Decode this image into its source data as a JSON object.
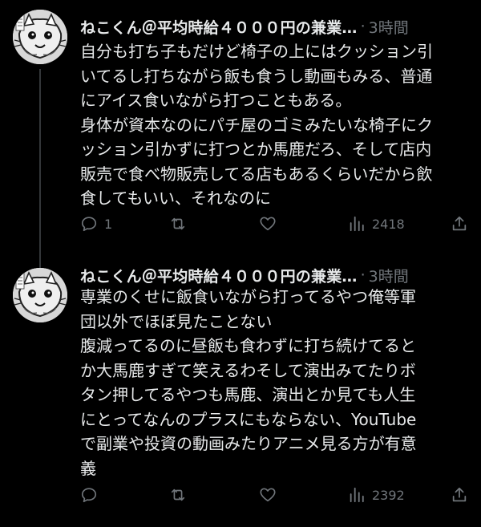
{
  "thread": {
    "tweets": [
      {
        "author": "ねこくん＠平均時給４０００円の兼業…",
        "time": "3時間",
        "more": "···",
        "lines": [
          "自分も打ち子もだけど椅子の上にはクッション引",
          "いてるし打ちながら飯も食うし動画もみる、普通",
          "にアイス食いながら打つこともある。",
          "身体が資本なのにパチ屋のゴミみたいな椅子にク",
          "ッション引かずに打つとか馬鹿だろ、そして店内",
          "販売で食べ物販売してる店もあるくらいだから飲",
          "食してもいい、それなのに"
        ],
        "actions": {
          "reply_count": "1",
          "retweet_count": "",
          "like_count": "",
          "views_count": "2418"
        }
      },
      {
        "author": "ねこくん＠平均時給４０００円の兼業…",
        "time": "3時間",
        "more": "···",
        "lines": [
          "専業のくせに飯食いながら打ってるやつ俺等軍",
          "団以外でほぼ見たことない",
          "腹減ってるのに昼飯も食わずに打ち続けてると",
          "か大馬鹿すぎて笑えるわそして演出みてたりボ",
          "タン押してるやつも馬鹿、演出とか見ても人生",
          "にとってなんのプラスにもならない、YouTube",
          "で副業や投資の動画みたりアニメ見る方が有意",
          "義"
        ],
        "actions": {
          "reply_count": "",
          "retweet_count": "",
          "like_count": "",
          "views_count": "2392"
        }
      }
    ]
  },
  "icons": {
    "reply": "speech-bubble-icon",
    "retweet": "retweet-arrows-icon",
    "like": "heart-icon",
    "views": "bar-chart-icon",
    "share": "share-upload-icon"
  },
  "colors": {
    "background": "#000000",
    "text": "#e7e9ea",
    "secondary": "#71767b",
    "thread_line": "#333639"
  }
}
